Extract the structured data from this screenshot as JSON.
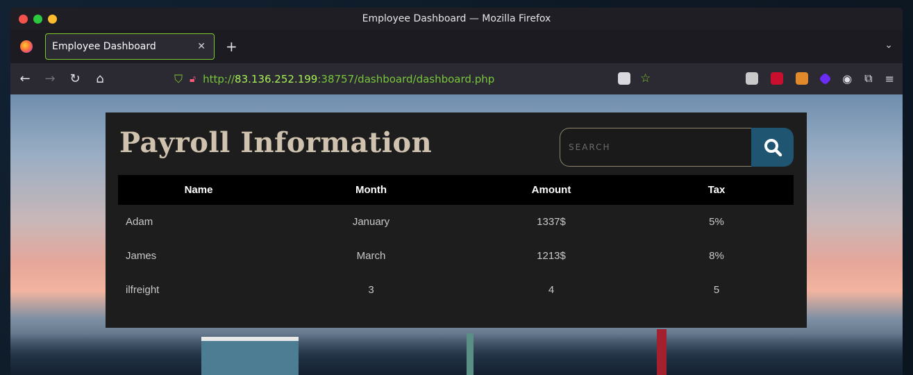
{
  "window": {
    "title": "Employee Dashboard — Mozilla Firefox"
  },
  "tabs": [
    {
      "label": "Employee Dashboard"
    }
  ],
  "navbar": {
    "url_scheme": "http://",
    "url_host": "83.136.252.199",
    "url_rest": ":38757/dashboard/dashboard.php"
  },
  "page": {
    "title": "Payroll Information",
    "search": {
      "placeholder": "SEARCH",
      "value": ""
    },
    "table": {
      "headers": [
        "Name",
        "Month",
        "Amount",
        "Tax"
      ],
      "rows": [
        [
          "Adam",
          "January",
          "1337$",
          "5%"
        ],
        [
          "James",
          "March",
          "1213$",
          "8%"
        ],
        [
          "ilfreight",
          "3",
          "4",
          "5"
        ]
      ]
    }
  },
  "colors": {
    "accent_url": "#a8f054",
    "search_button": "#1f5570",
    "panel_title": "#cfc2ae"
  }
}
